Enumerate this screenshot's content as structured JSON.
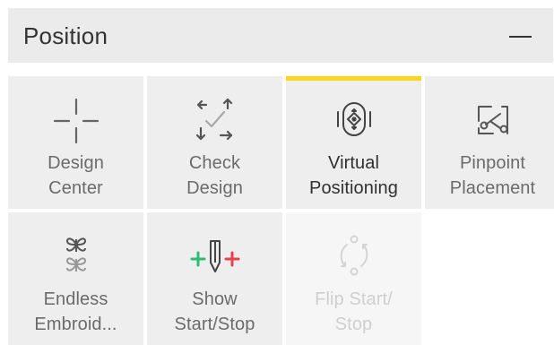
{
  "panel": {
    "title": "Position",
    "collapse_icon": "minus-icon"
  },
  "tiles": [
    {
      "icon": "crosshair-icon",
      "line1": "Design",
      "line2": "Center",
      "state": "normal"
    },
    {
      "icon": "check-design-arrows-icon",
      "line1": "Check",
      "line2": "Design",
      "state": "normal"
    },
    {
      "icon": "virtual-positioning-icon",
      "line1": "Virtual",
      "line2": "Positioning",
      "state": "active"
    },
    {
      "icon": "pinpoint-placement-icon",
      "line1": "Pinpoint",
      "line2": "Placement",
      "state": "normal"
    },
    {
      "icon": "endless-embroidery-icon",
      "line1": "Endless",
      "line2": "Embroid...",
      "state": "normal"
    },
    {
      "icon": "show-start-stop-icon",
      "line1": "Show",
      "line2": "Start/Stop",
      "state": "normal"
    },
    {
      "icon": "flip-start-stop-icon",
      "line1": "Flip Start/",
      "line2": "Stop",
      "state": "disabled"
    }
  ],
  "colors": {
    "header_bg": "#ebebeb",
    "tile_bg": "#eeeeee",
    "active_accent": "#fdd51c",
    "icon_gray": "#666666",
    "start_green": "#2bbd6e",
    "stop_red": "#e8434a",
    "disabled_text": "#cfcfcf"
  }
}
